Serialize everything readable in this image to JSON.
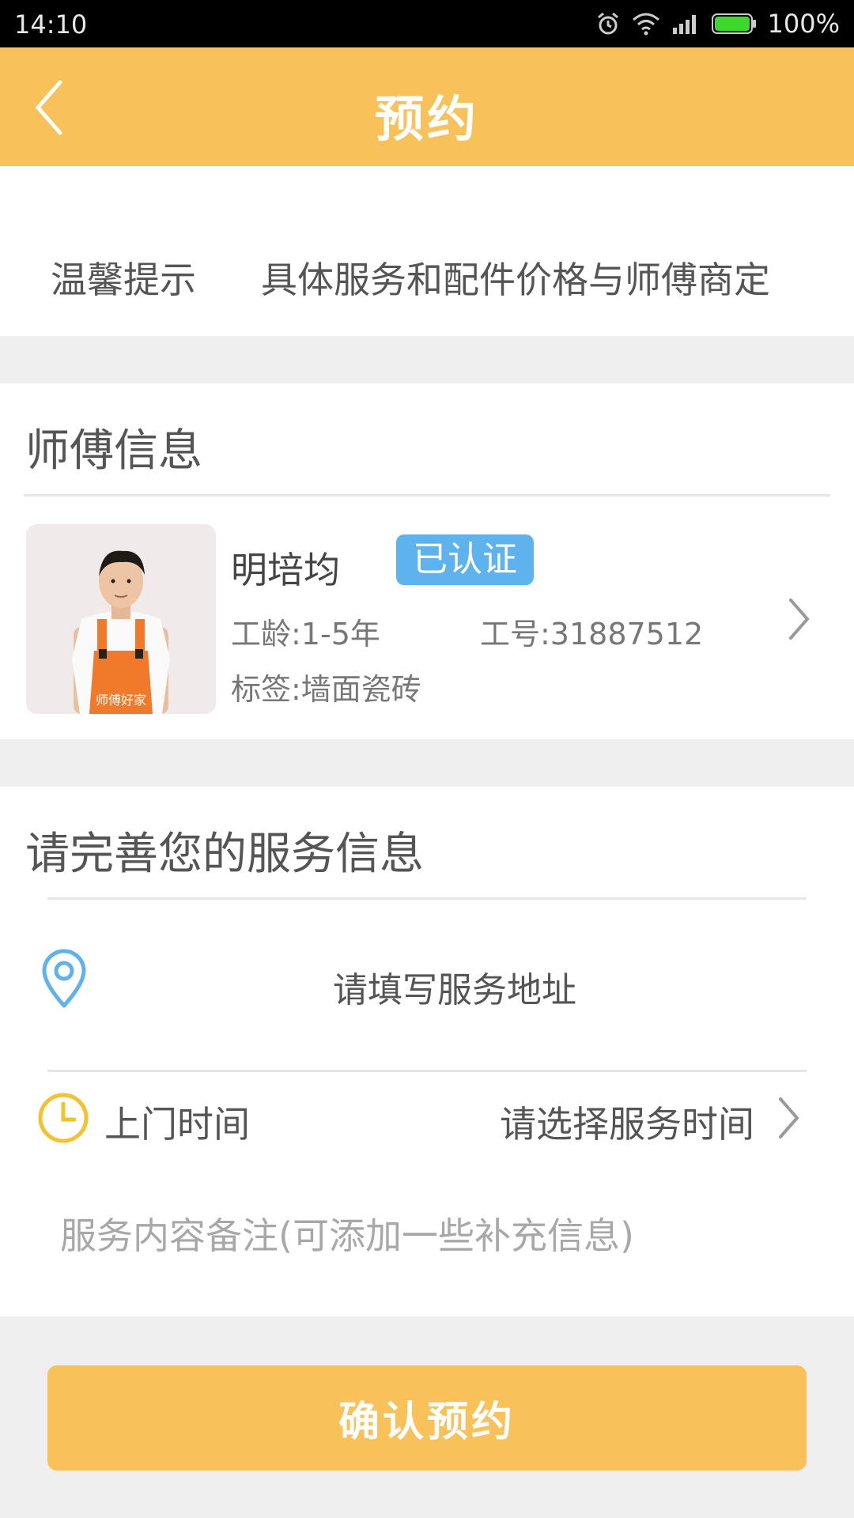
{
  "status_bar": {
    "time": "14:10",
    "battery": "100%",
    "icons": [
      "alarm-icon",
      "wifi-icon",
      "signal-icon",
      "battery-icon"
    ]
  },
  "header": {
    "title": "预约",
    "back_icon": "chevron-left-icon"
  },
  "tip": {
    "label": "温馨提示",
    "text": "具体服务和配件价格与师傅商定"
  },
  "master_section": {
    "title": "师傅信息",
    "name": "明培均",
    "badge": "已认证",
    "work_age": "工龄:1-5年",
    "work_id": "工号:31887512",
    "tags": "标签:墙面瓷砖",
    "photo_vest_text": "师傅好家"
  },
  "service_section": {
    "title": "请完善您的服务信息",
    "address_placeholder": "请填写服务地址",
    "time_label": "上门时间",
    "time_placeholder": "请选择服务时间",
    "remark_placeholder": "服务内容备注(可添加一些补充信息)"
  },
  "confirm_button": {
    "label": "确认预约"
  },
  "colors": {
    "accent": "#f9c15a",
    "badge": "#5eb3ee",
    "location_icon": "#5eb3ee",
    "clock_icon": "#f5c12e"
  }
}
